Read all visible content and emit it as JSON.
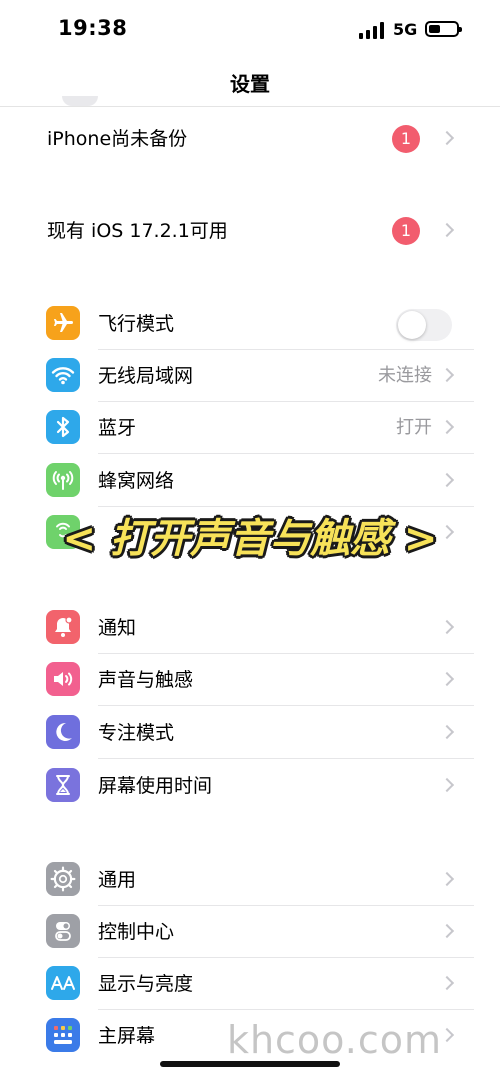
{
  "status": {
    "time": "19:38",
    "network": "5G"
  },
  "nav": {
    "title": "设置"
  },
  "alerts": [
    {
      "label": "iPhone尚未备份",
      "badge": "1"
    },
    {
      "label": "现有 iOS 17.2.1可用",
      "badge": "1"
    }
  ],
  "connectivity": [
    {
      "label": "飞行模式",
      "icon": "airplane-icon",
      "color": "#f7a21b"
    },
    {
      "label": "无线局域网",
      "value": "未连接",
      "icon": "wifi-icon",
      "color": "#2ea8ea"
    },
    {
      "label": "蓝牙",
      "value": "打开",
      "icon": "bluetooth-icon",
      "color": "#2ea8ea"
    },
    {
      "label": "蜂窝网络",
      "icon": "cellular-icon",
      "color": "#6fd26b"
    },
    {
      "label": "",
      "icon": "hotspot-icon",
      "color": "#6fd26b"
    }
  ],
  "banner": {
    "text": "< 打开声音与触感 >"
  },
  "notifications": [
    {
      "label": "通知",
      "icon": "notification-icon",
      "color": "#f2636c"
    },
    {
      "label": "声音与触感",
      "icon": "speaker-icon",
      "color": "#f2608f"
    },
    {
      "label": "专注模式",
      "icon": "moon-icon",
      "color": "#6f6fdd"
    },
    {
      "label": "屏幕使用时间",
      "icon": "hourglass-icon",
      "color": "#7a73dd"
    }
  ],
  "general": [
    {
      "label": "通用",
      "icon": "gear-icon",
      "color": "#9ea0a6"
    },
    {
      "label": "控制中心",
      "icon": "toggles-icon",
      "color": "#9ea0a6"
    },
    {
      "label": "显示与亮度",
      "icon": "text-size-icon",
      "color": "#2ea8ea"
    },
    {
      "label": "主屏幕",
      "icon": "home-screen-icon",
      "color": "#3b7be8"
    }
  ],
  "watermark": "khcoo.com"
}
